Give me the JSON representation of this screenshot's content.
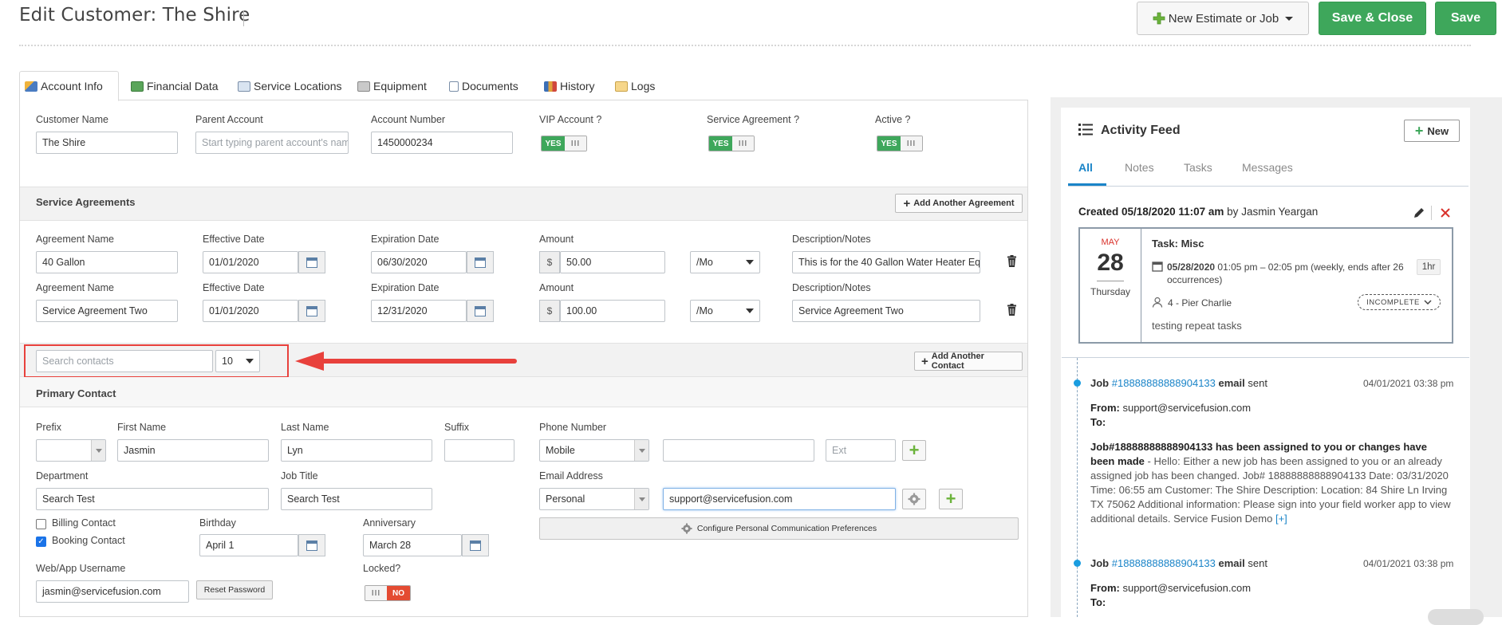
{
  "header": {
    "title": "Edit Customer: The Shire",
    "new_estimate_label": "New Estimate or Job",
    "save_close_label": "Save & Close",
    "save_label": "Save"
  },
  "tabs": [
    {
      "label": "Account Info",
      "icon": "account-icon",
      "active": true
    },
    {
      "label": "Financial Data",
      "icon": "money-icon"
    },
    {
      "label": "Service Locations",
      "icon": "map-icon"
    },
    {
      "label": "Equipment",
      "icon": "equipment-icon"
    },
    {
      "label": "Documents",
      "icon": "document-icon"
    },
    {
      "label": "History",
      "icon": "chart-icon"
    },
    {
      "label": "Logs",
      "icon": "envelope-icon"
    }
  ],
  "account": {
    "customer_name_label": "Customer Name",
    "customer_name_value": "The Shire",
    "parent_account_label": "Parent Account",
    "parent_account_placeholder": "Start typing parent account's nam",
    "account_number_label": "Account Number",
    "account_number_value": "1450000234",
    "vip_label": "VIP Account ?",
    "service_agreement_label": "Service Agreement ?",
    "active_label": "Active ?",
    "yes": "YES",
    "no": "NO",
    "off_glyph": "III"
  },
  "agreements": {
    "section_title": "Service Agreements",
    "add_button": "Add Another Agreement",
    "labels": {
      "name": "Agreement Name",
      "effective": "Effective Date",
      "expiration": "Expiration Date",
      "amount": "Amount",
      "notes": "Description/Notes"
    },
    "currency": "$",
    "rows": [
      {
        "name": "40 Gallon",
        "effective": "01/01/2020",
        "expiration": "06/30/2020",
        "amount": "50.00",
        "period": "/Mo",
        "notes": "This is for the 40 Gallon Water Heater Eq"
      },
      {
        "name": "Service Agreement Two",
        "effective": "01/01/2020",
        "expiration": "12/31/2020",
        "amount": "100.00",
        "period": "/Mo",
        "notes": "Service Agreement Two"
      }
    ]
  },
  "contacts": {
    "search_placeholder": "Search contacts",
    "page_size": "10",
    "add_button": "Add Another Contact",
    "primary_title": "Primary Contact",
    "prefix_label": "Prefix",
    "first_name_label": "First Name",
    "first_name_value": "Jasmin",
    "last_name_label": "Last Name",
    "last_name_value": "Lyn",
    "suffix_label": "Suffix",
    "phone_label": "Phone Number",
    "phone_type": "Mobile",
    "ext_placeholder": "Ext",
    "department_label": "Department",
    "department_value": "Search Test",
    "job_title_label": "Job Title",
    "job_title_value": "Search Test",
    "email_label": "Email Address",
    "email_type": "Personal",
    "email_value": "support@servicefusion.com",
    "billing_contact": "Billing Contact",
    "booking_contact": "Booking Contact",
    "birthday_label": "Birthday",
    "birthday_value": "April 1",
    "anniversary_label": "Anniversary",
    "anniversary_value": "March 28",
    "comm_prefs_button": "Configure Personal Communication Preferences",
    "username_label": "Web/App Username",
    "username_value": "jasmin@servicefusion.com",
    "reset_password": "Reset Password",
    "locked_label": "Locked?"
  },
  "activity": {
    "title": "Activity Feed",
    "new_button": "New",
    "tabs": [
      "All",
      "Notes",
      "Tasks",
      "Messages"
    ],
    "created_prefix": "Created 05/18/2020 11:07 am",
    "created_by_word": "by",
    "created_by": "Jasmin Yeargan",
    "task": {
      "month": "MAY",
      "day": "28",
      "weekday": "Thursday",
      "title": "Task: Misc",
      "date": "05/28/2020",
      "time": "01:05 pm – 02:05 pm (weekly, ends after 26 occurrences)",
      "duration": "1hr",
      "assignee": "4 - Pier Charlie",
      "status": "INCOMPLETE",
      "note": "testing repeat tasks"
    },
    "entries": [
      {
        "prefix": "Job",
        "link": "#18888888888904133",
        "suffix": "email",
        "verb": "sent",
        "timestamp": "04/01/2021 03:38 pm",
        "from_label": "From:",
        "from": "support@servicefusion.com",
        "to_label": "To:",
        "headline": "Job#18888888888904133 has been assigned to you or changes have been made",
        "body": " - Hello:   Either a new job has been assigned to you or an already assigned job has been changed.   Job# 18888888888904133 Date: 03/31/2020 Time: 06:55 am Customer: The Shire Description: Location: 84 Shire Ln  Irving TX 75062  Additional information:    Please sign into your field worker app to view additional details.   Service Fusion Demo",
        "more": "[+]"
      },
      {
        "prefix": "Job",
        "link": "#18888888888904133",
        "suffix": "email",
        "verb": "sent",
        "timestamp": "04/01/2021 03:38 pm",
        "from_label": "From:",
        "from": "support@servicefusion.com",
        "to_label": "To:"
      }
    ]
  },
  "colors": {
    "accent_green": "#3ea75b",
    "link_blue": "#1a84c8",
    "annotation_red": "#e8413c"
  }
}
